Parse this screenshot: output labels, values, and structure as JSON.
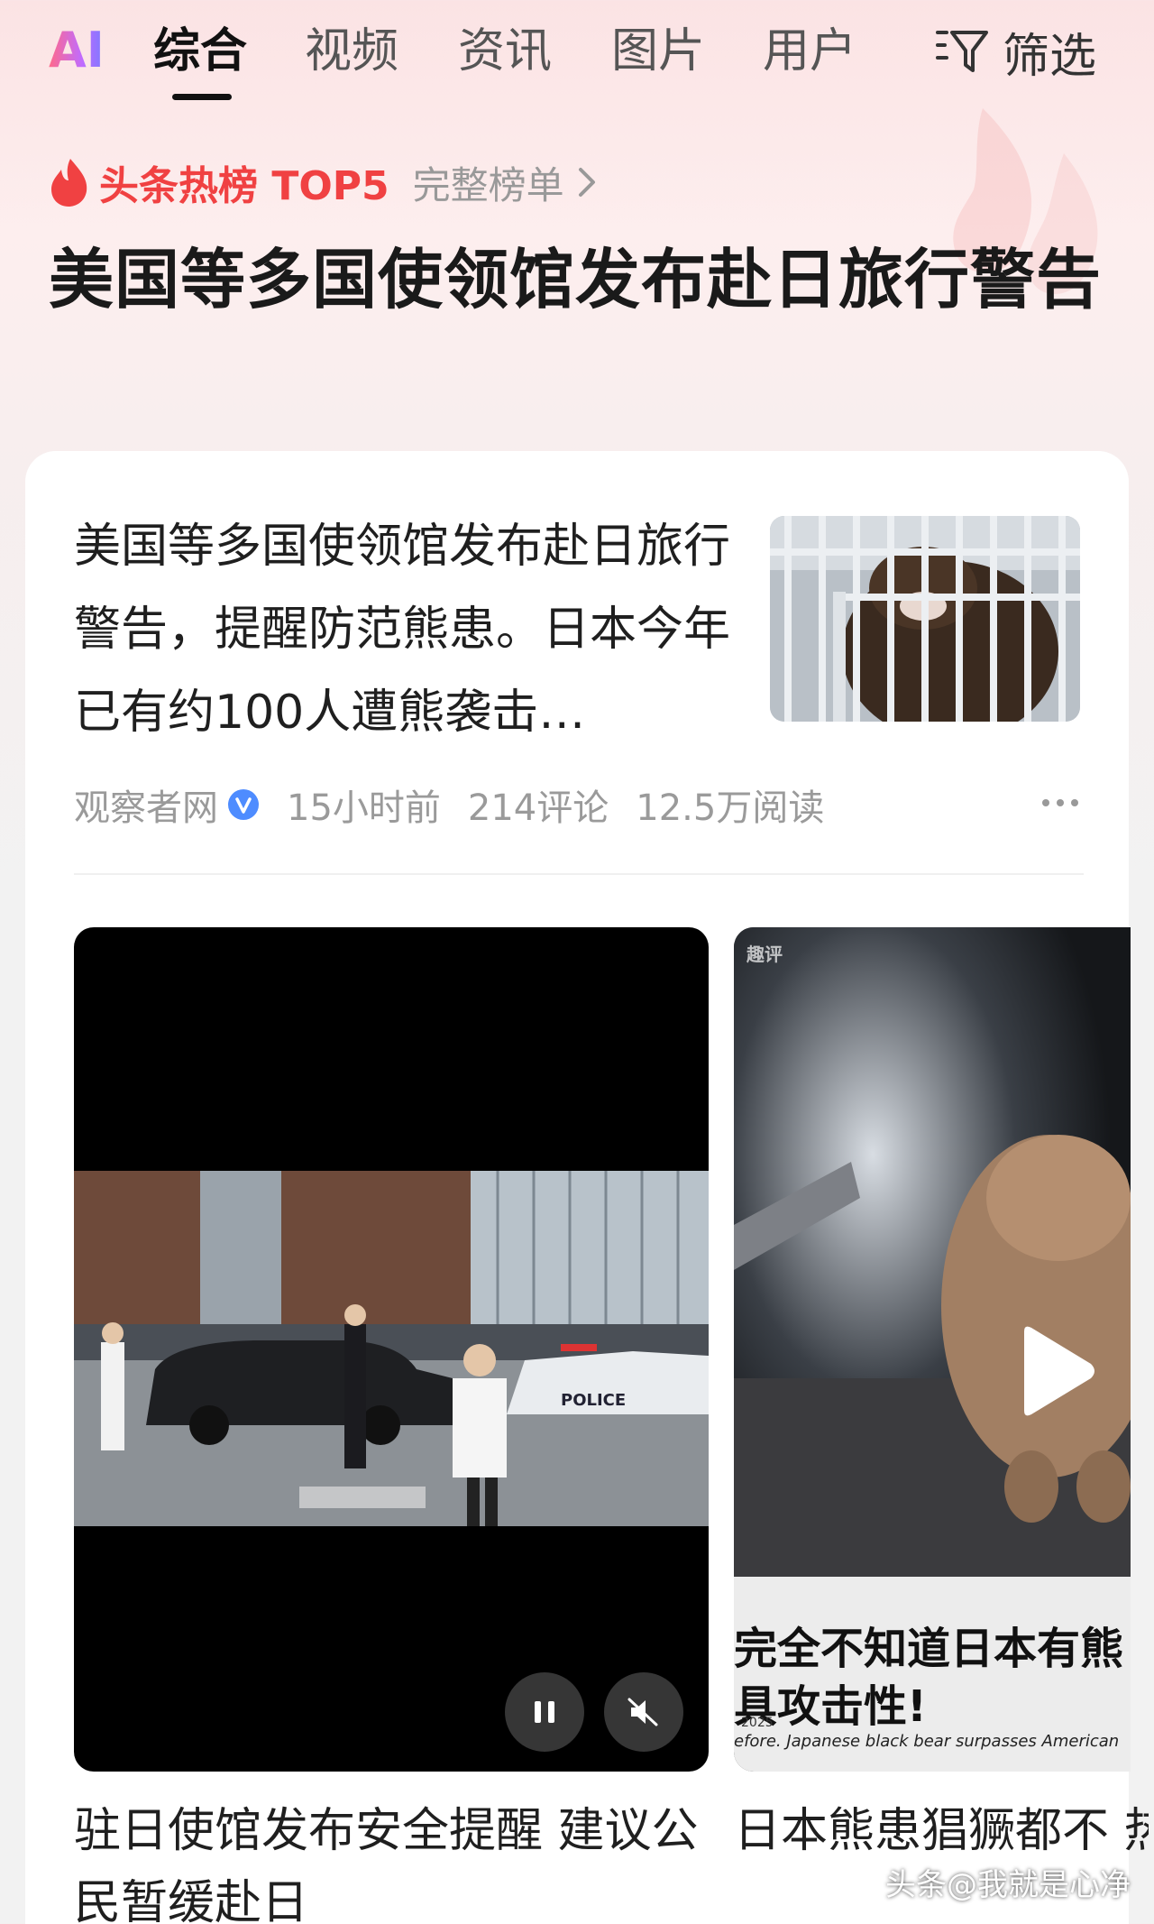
{
  "tabs": {
    "ai": "AI",
    "items": [
      "综合",
      "视频",
      "资讯",
      "图片",
      "用户"
    ],
    "filter": "筛选"
  },
  "hot_list": {
    "title": "头条热榜 TOP5",
    "more": "完整榜单",
    "headline": "美国等多国使领馆发布赴日旅行警告"
  },
  "article": {
    "text": "美国等多国使领馆发布赴日旅行警告，提醒防范熊患。日本今年已有约100人遭熊袭击…",
    "source": "观察者网",
    "time": "15小时前",
    "comments": "214评论",
    "reads": "12.5万阅读"
  },
  "videos": [
    {
      "title": "驻日使馆发布安全提醒 建议公民暂缓赴日",
      "overlay_text": "POLICE"
    },
    {
      "title": "日本熊患猖獗都不 热评 - 能只是想让你",
      "caption_line1": "完全不知道日本有熊",
      "caption_line2": "具攻击性!",
      "caption_year": "2025",
      "caption_en": "efore. Japanese black bear surpasses American",
      "corner_tag": "趣评"
    }
  ],
  "watermark": "头条@我就是心净",
  "colors": {
    "accent_red": "#f04142",
    "verified_blue": "#4e8cff",
    "text_primary": "#1f1f1f",
    "text_meta": "#9a9a9a"
  }
}
